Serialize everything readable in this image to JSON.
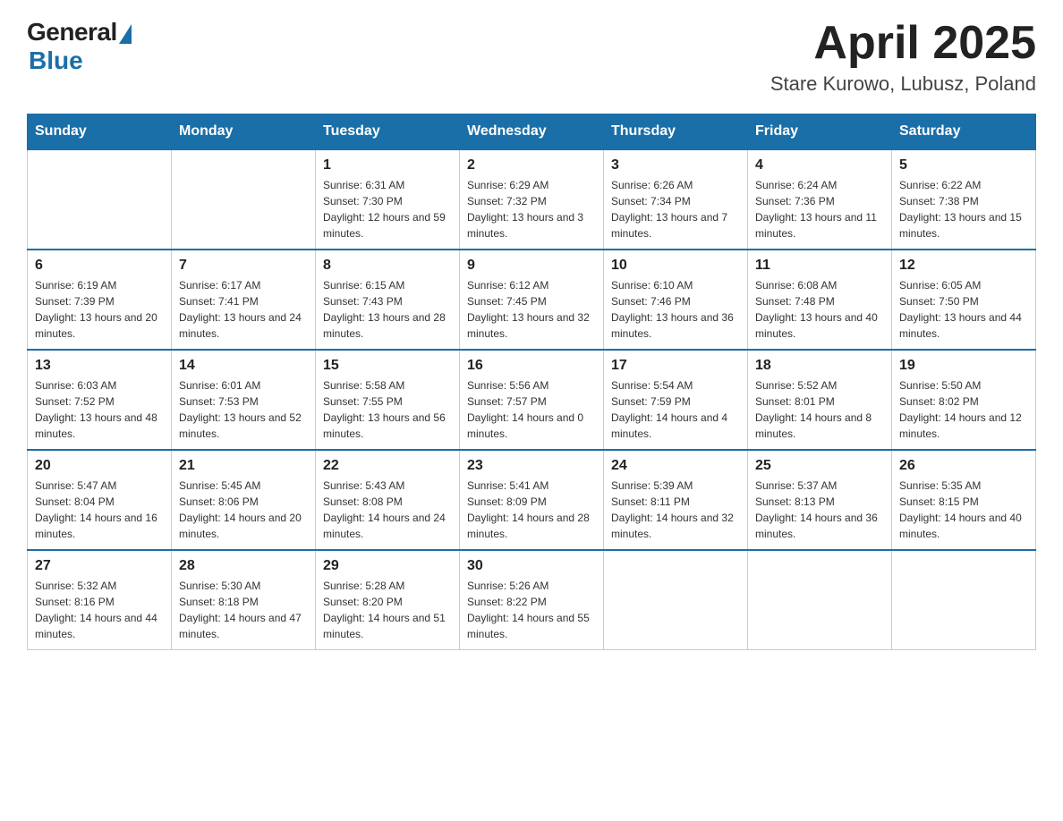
{
  "header": {
    "logo_general": "General",
    "logo_blue": "Blue",
    "title": "April 2025",
    "location": "Stare Kurowo, Lubusz, Poland"
  },
  "days_of_week": [
    "Sunday",
    "Monday",
    "Tuesday",
    "Wednesday",
    "Thursday",
    "Friday",
    "Saturday"
  ],
  "weeks": [
    [
      {
        "day": "",
        "sunrise": "",
        "sunset": "",
        "daylight": ""
      },
      {
        "day": "",
        "sunrise": "",
        "sunset": "",
        "daylight": ""
      },
      {
        "day": "1",
        "sunrise": "Sunrise: 6:31 AM",
        "sunset": "Sunset: 7:30 PM",
        "daylight": "Daylight: 12 hours and 59 minutes."
      },
      {
        "day": "2",
        "sunrise": "Sunrise: 6:29 AM",
        "sunset": "Sunset: 7:32 PM",
        "daylight": "Daylight: 13 hours and 3 minutes."
      },
      {
        "day": "3",
        "sunrise": "Sunrise: 6:26 AM",
        "sunset": "Sunset: 7:34 PM",
        "daylight": "Daylight: 13 hours and 7 minutes."
      },
      {
        "day": "4",
        "sunrise": "Sunrise: 6:24 AM",
        "sunset": "Sunset: 7:36 PM",
        "daylight": "Daylight: 13 hours and 11 minutes."
      },
      {
        "day": "5",
        "sunrise": "Sunrise: 6:22 AM",
        "sunset": "Sunset: 7:38 PM",
        "daylight": "Daylight: 13 hours and 15 minutes."
      }
    ],
    [
      {
        "day": "6",
        "sunrise": "Sunrise: 6:19 AM",
        "sunset": "Sunset: 7:39 PM",
        "daylight": "Daylight: 13 hours and 20 minutes."
      },
      {
        "day": "7",
        "sunrise": "Sunrise: 6:17 AM",
        "sunset": "Sunset: 7:41 PM",
        "daylight": "Daylight: 13 hours and 24 minutes."
      },
      {
        "day": "8",
        "sunrise": "Sunrise: 6:15 AM",
        "sunset": "Sunset: 7:43 PM",
        "daylight": "Daylight: 13 hours and 28 minutes."
      },
      {
        "day": "9",
        "sunrise": "Sunrise: 6:12 AM",
        "sunset": "Sunset: 7:45 PM",
        "daylight": "Daylight: 13 hours and 32 minutes."
      },
      {
        "day": "10",
        "sunrise": "Sunrise: 6:10 AM",
        "sunset": "Sunset: 7:46 PM",
        "daylight": "Daylight: 13 hours and 36 minutes."
      },
      {
        "day": "11",
        "sunrise": "Sunrise: 6:08 AM",
        "sunset": "Sunset: 7:48 PM",
        "daylight": "Daylight: 13 hours and 40 minutes."
      },
      {
        "day": "12",
        "sunrise": "Sunrise: 6:05 AM",
        "sunset": "Sunset: 7:50 PM",
        "daylight": "Daylight: 13 hours and 44 minutes."
      }
    ],
    [
      {
        "day": "13",
        "sunrise": "Sunrise: 6:03 AM",
        "sunset": "Sunset: 7:52 PM",
        "daylight": "Daylight: 13 hours and 48 minutes."
      },
      {
        "day": "14",
        "sunrise": "Sunrise: 6:01 AM",
        "sunset": "Sunset: 7:53 PM",
        "daylight": "Daylight: 13 hours and 52 minutes."
      },
      {
        "day": "15",
        "sunrise": "Sunrise: 5:58 AM",
        "sunset": "Sunset: 7:55 PM",
        "daylight": "Daylight: 13 hours and 56 minutes."
      },
      {
        "day": "16",
        "sunrise": "Sunrise: 5:56 AM",
        "sunset": "Sunset: 7:57 PM",
        "daylight": "Daylight: 14 hours and 0 minutes."
      },
      {
        "day": "17",
        "sunrise": "Sunrise: 5:54 AM",
        "sunset": "Sunset: 7:59 PM",
        "daylight": "Daylight: 14 hours and 4 minutes."
      },
      {
        "day": "18",
        "sunrise": "Sunrise: 5:52 AM",
        "sunset": "Sunset: 8:01 PM",
        "daylight": "Daylight: 14 hours and 8 minutes."
      },
      {
        "day": "19",
        "sunrise": "Sunrise: 5:50 AM",
        "sunset": "Sunset: 8:02 PM",
        "daylight": "Daylight: 14 hours and 12 minutes."
      }
    ],
    [
      {
        "day": "20",
        "sunrise": "Sunrise: 5:47 AM",
        "sunset": "Sunset: 8:04 PM",
        "daylight": "Daylight: 14 hours and 16 minutes."
      },
      {
        "day": "21",
        "sunrise": "Sunrise: 5:45 AM",
        "sunset": "Sunset: 8:06 PM",
        "daylight": "Daylight: 14 hours and 20 minutes."
      },
      {
        "day": "22",
        "sunrise": "Sunrise: 5:43 AM",
        "sunset": "Sunset: 8:08 PM",
        "daylight": "Daylight: 14 hours and 24 minutes."
      },
      {
        "day": "23",
        "sunrise": "Sunrise: 5:41 AM",
        "sunset": "Sunset: 8:09 PM",
        "daylight": "Daylight: 14 hours and 28 minutes."
      },
      {
        "day": "24",
        "sunrise": "Sunrise: 5:39 AM",
        "sunset": "Sunset: 8:11 PM",
        "daylight": "Daylight: 14 hours and 32 minutes."
      },
      {
        "day": "25",
        "sunrise": "Sunrise: 5:37 AM",
        "sunset": "Sunset: 8:13 PM",
        "daylight": "Daylight: 14 hours and 36 minutes."
      },
      {
        "day": "26",
        "sunrise": "Sunrise: 5:35 AM",
        "sunset": "Sunset: 8:15 PM",
        "daylight": "Daylight: 14 hours and 40 minutes."
      }
    ],
    [
      {
        "day": "27",
        "sunrise": "Sunrise: 5:32 AM",
        "sunset": "Sunset: 8:16 PM",
        "daylight": "Daylight: 14 hours and 44 minutes."
      },
      {
        "day": "28",
        "sunrise": "Sunrise: 5:30 AM",
        "sunset": "Sunset: 8:18 PM",
        "daylight": "Daylight: 14 hours and 47 minutes."
      },
      {
        "day": "29",
        "sunrise": "Sunrise: 5:28 AM",
        "sunset": "Sunset: 8:20 PM",
        "daylight": "Daylight: 14 hours and 51 minutes."
      },
      {
        "day": "30",
        "sunrise": "Sunrise: 5:26 AM",
        "sunset": "Sunset: 8:22 PM",
        "daylight": "Daylight: 14 hours and 55 minutes."
      },
      {
        "day": "",
        "sunrise": "",
        "sunset": "",
        "daylight": ""
      },
      {
        "day": "",
        "sunrise": "",
        "sunset": "",
        "daylight": ""
      },
      {
        "day": "",
        "sunrise": "",
        "sunset": "",
        "daylight": ""
      }
    ]
  ]
}
